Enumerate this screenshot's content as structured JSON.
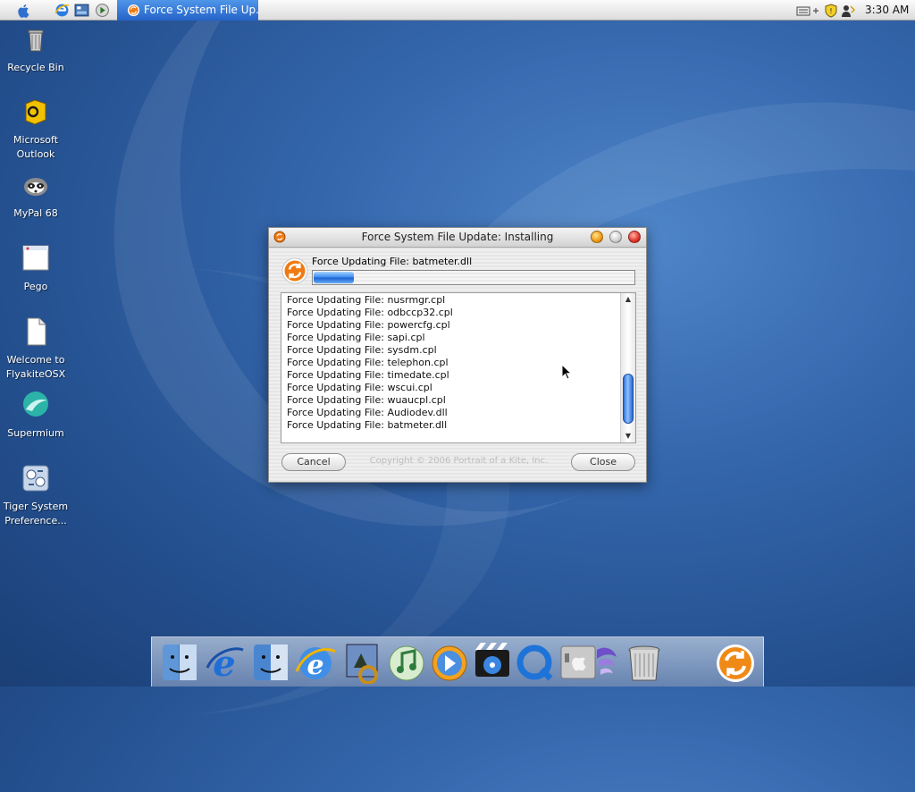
{
  "menubar": {
    "task_button_label": "Force System File Up...",
    "clock": "3:30 AM"
  },
  "desktop": {
    "icons": [
      {
        "label": "Recycle Bin",
        "icon": "recycle-bin-icon"
      },
      {
        "label": "Microsoft Outlook",
        "icon": "outlook-icon"
      },
      {
        "label": "MyPal 68",
        "icon": "mypal-icon"
      },
      {
        "label": "Pego",
        "icon": "pego-icon"
      },
      {
        "label": "Welcome to FlyakiteOSX",
        "icon": "document-icon"
      },
      {
        "label": "Supermium",
        "icon": "supermium-icon"
      },
      {
        "label": "Tiger System Preference...",
        "icon": "system-preferences-icon"
      }
    ]
  },
  "dialog": {
    "title": "Force System File Update: Installing",
    "current_file": "Force Updating File: batmeter.dll",
    "progress_fraction": 0.13,
    "log": [
      "Force Updating File: nusrmgr.cpl",
      "Force Updating File: odbccp32.cpl",
      "Force Updating File: powercfg.cpl",
      "Force Updating File: sapi.cpl",
      "Force Updating File: sysdm.cpl",
      "Force Updating File: telephon.cpl",
      "Force Updating File: timedate.cpl",
      "Force Updating File: wscui.cpl",
      "Force Updating File: wuaucpl.cpl",
      "Force Updating File: Audiodev.dll",
      "Force Updating File: batmeter.dll"
    ],
    "scroll_position": 0.92,
    "cancel_label": "Cancel",
    "close_label": "Close",
    "copyright": "Copyright © 2006 Portrait of a Kite, Inc."
  },
  "dock": {
    "items": [
      "finder-icon",
      "internet-explorer-icon",
      "finder-alt-icon",
      "ie-alt-icon",
      "preview-icon",
      "itunes-icon",
      "quicktime-player-icon",
      "dvd-player-icon",
      "quicktime-icon",
      "apple-system-icon",
      "trash-icon",
      "update-icon"
    ]
  },
  "colors": {
    "accent": "#2563c8",
    "desktop": "#3567ad"
  }
}
